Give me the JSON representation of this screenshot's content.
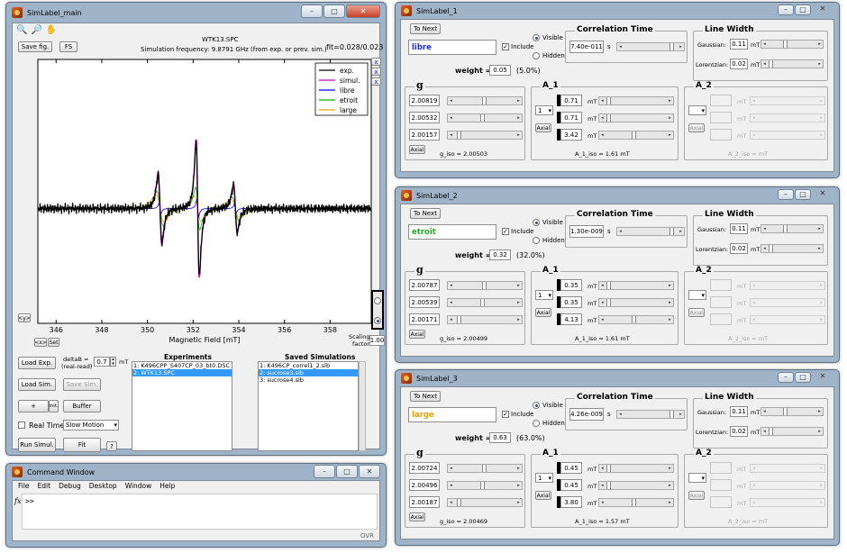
{
  "main": {
    "title": "SimLabel_main",
    "toolbar_icons": [
      "zoom-in-icon",
      "zoom-out-icon",
      "pan-hand-icon"
    ],
    "save_fig": "Save fig.",
    "fs": "FS",
    "file": "WTK13.SPC",
    "sim_freq": "Simulation frequency: 9.8791 GHz (from exp. or prev. sim.)",
    "fit": "fit=0.028/0.023",
    "x_small_1": "x",
    "x_small_2": "x",
    "x_small_3": "x",
    "left_arrow": "<y>",
    "zoom_btn": "<x>",
    "set_btn": "Set",
    "scaling_label_1": "Scaling",
    "scaling_label_2": "factor",
    "scaling_value": "1.00",
    "load_exp": "Load Exp.",
    "load_sim": "Load Sim.",
    "save_sim": "Save Sim.",
    "plus": "+",
    "init": "init.",
    "buffer": "Buffer",
    "deltab_label_1": "deltaB =",
    "deltab_label_2": "(real-read)",
    "deltab_value": "0.7",
    "deltab_unit": "mT",
    "real_time": "Real Time",
    "motion": "Slow Motion",
    "run_simul": "Run Simul.",
    "fit_btn": "Fit",
    "help_btn": "?",
    "experiments_title": "Experiments",
    "experiments": [
      "1: K496CPP_S407CP_03_bt0.DSC",
      "2: WTK13.SPC"
    ],
    "saved_title": "Saved Simulations",
    "saved": [
      "1: K496CP_correl1_2.slb",
      "2: sucrose3.slb",
      "3: sucrose4.slb"
    ]
  },
  "chart_data": {
    "type": "line",
    "xlabel": "Magnetic Field [mT]",
    "xlim": [
      345.2,
      359.8
    ],
    "x_ticks": [
      346,
      348,
      350,
      352,
      354,
      356,
      358
    ],
    "series": [
      {
        "name": "exp.",
        "color": "#000000"
      },
      {
        "name": "simul.",
        "color": "#cc00cc"
      },
      {
        "name": "libre",
        "color": "#0000ff"
      },
      {
        "name": "etroit",
        "color": "#00b000"
      },
      {
        "name": "large",
        "color": "#e8a000"
      }
    ],
    "legend": "top-right"
  },
  "cmd": {
    "title": "Command Window",
    "menu": [
      "File",
      "Edit",
      "Debug",
      "Desktop",
      "Window",
      "Help"
    ],
    "prompt": ">>",
    "fx": "fx",
    "status": "OVR"
  },
  "labels": [
    {
      "title": "SimLabel_1",
      "name": "libre",
      "name_color": "#1f2bd6",
      "weight": "0.05",
      "weight_pct": "(5.0%)",
      "corr": "7.40e-011",
      "gauss": "0.11",
      "lor": "0.02",
      "g": [
        "2.00819",
        "2.00532",
        "2.00157"
      ],
      "giso": "g_iso = 2.00503",
      "a1_sel": "1",
      "a1": [
        "0.71",
        "0.71",
        "3.42"
      ],
      "a1iso": "A_1_iso = 1.61  mT"
    },
    {
      "title": "SimLabel_2",
      "name": "etroit",
      "name_color": "#2fa02f",
      "weight": "0.32",
      "weight_pct": "(32.0%)",
      "corr": "1.30e-009",
      "gauss": "0.11",
      "lor": "0.02",
      "g": [
        "2.00787",
        "2.00539",
        "2.00171"
      ],
      "giso": "g_iso = 2.00499",
      "a1_sel": "1",
      "a1": [
        "0.35",
        "0.35",
        "4.13"
      ],
      "a1iso": "A_1_iso = 1.61  mT"
    },
    {
      "title": "SimLabel_3",
      "name": "large",
      "name_color": "#e8a000",
      "weight": "0.63",
      "weight_pct": "(63.0%)",
      "corr": "4.26e-009",
      "gauss": "0.11",
      "lor": "0.02",
      "g": [
        "2.00724",
        "2.00496",
        "2.00187"
      ],
      "giso": "g_iso = 2.00469",
      "a1_sel": "1",
      "a1": [
        "0.45",
        "0.45",
        "3.80"
      ],
      "a1iso": "A_1_iso = 1.57  mT"
    }
  ],
  "common": {
    "to_next": "To Next",
    "visible": "Visible",
    "hidden": "Hidden",
    "include": "Include",
    "corr_title": "Correlation Time",
    "s": "s",
    "lw_title": "Line Width",
    "gauss_label": "Gaussian:",
    "lor_label": "Lorentzian:",
    "mT": "mT",
    "weight_label": "weight =",
    "g_title": "g",
    "a1_title": "A_1",
    "a2_title": "A_2",
    "axial": "Axial",
    "a2iso": "A_2_iso =       mT"
  }
}
